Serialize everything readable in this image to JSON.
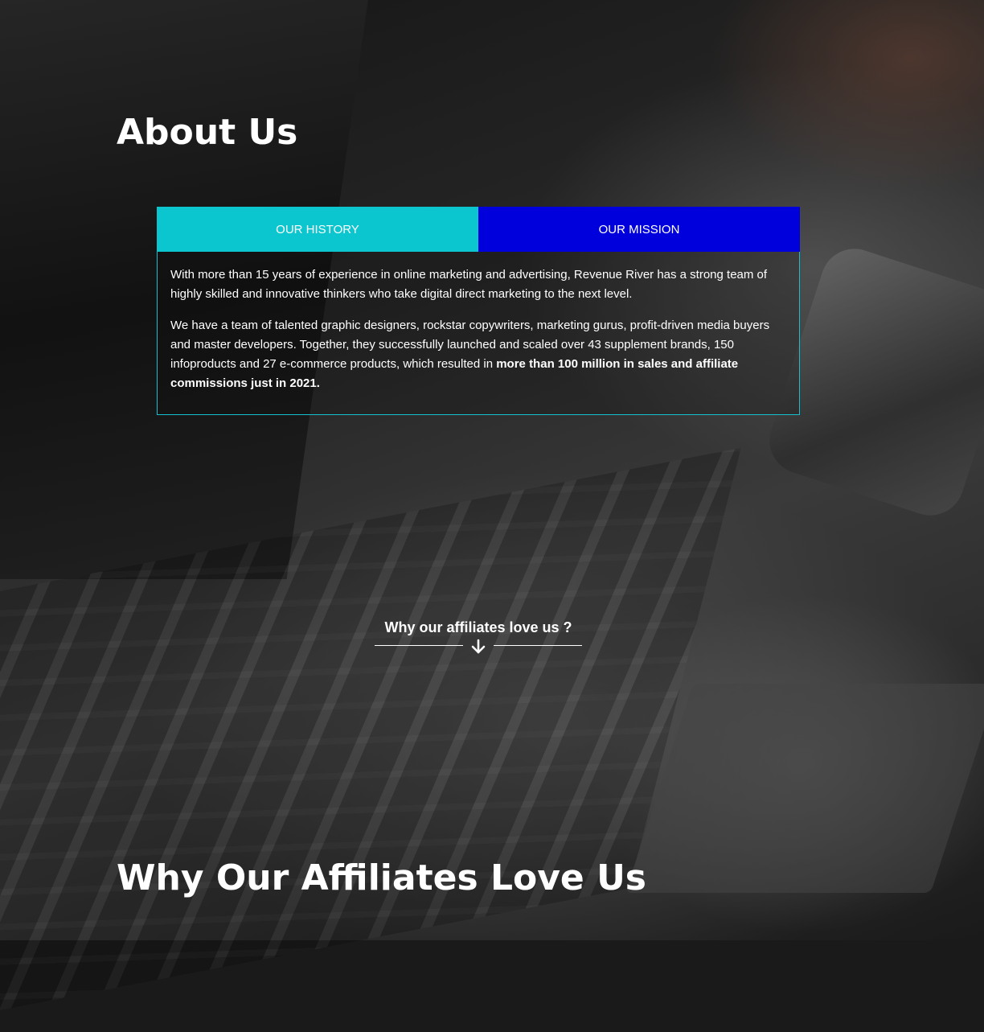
{
  "about": {
    "title": "About Us"
  },
  "tabs": [
    {
      "label": "OUR HISTORY",
      "color": "#0cc6cf",
      "active": true
    },
    {
      "label": "OUR MISSION",
      "color": "#0000dd",
      "active": false
    }
  ],
  "history": {
    "paragraph1": "With more than 15 years of experience in online marketing and advertising, Revenue River has a strong team of highly skilled and innovative thinkers who take digital direct marketing to the next level.",
    "paragraph2_text": "We have a team of talented graphic designers, rockstar copywriters, marketing gurus, profit-driven media buyers and master developers. Together, they successfully launched and scaled over 43 supplement brands, 150 infoproducts and 27 e-commerce products, which resulted in ",
    "paragraph2_bold": "more than 100 million in sales and affiliate commissions just in 2021."
  },
  "cta": {
    "label": "Why our affiliates love us ?",
    "icon": "arrow-down-icon"
  },
  "why": {
    "title": "Why Our Affiliates Love Us"
  },
  "colors": {
    "accent_cyan": "#0cc6cf",
    "accent_blue": "#0000dd",
    "panel_border": "#14bfd0",
    "text": "#ffffff"
  }
}
